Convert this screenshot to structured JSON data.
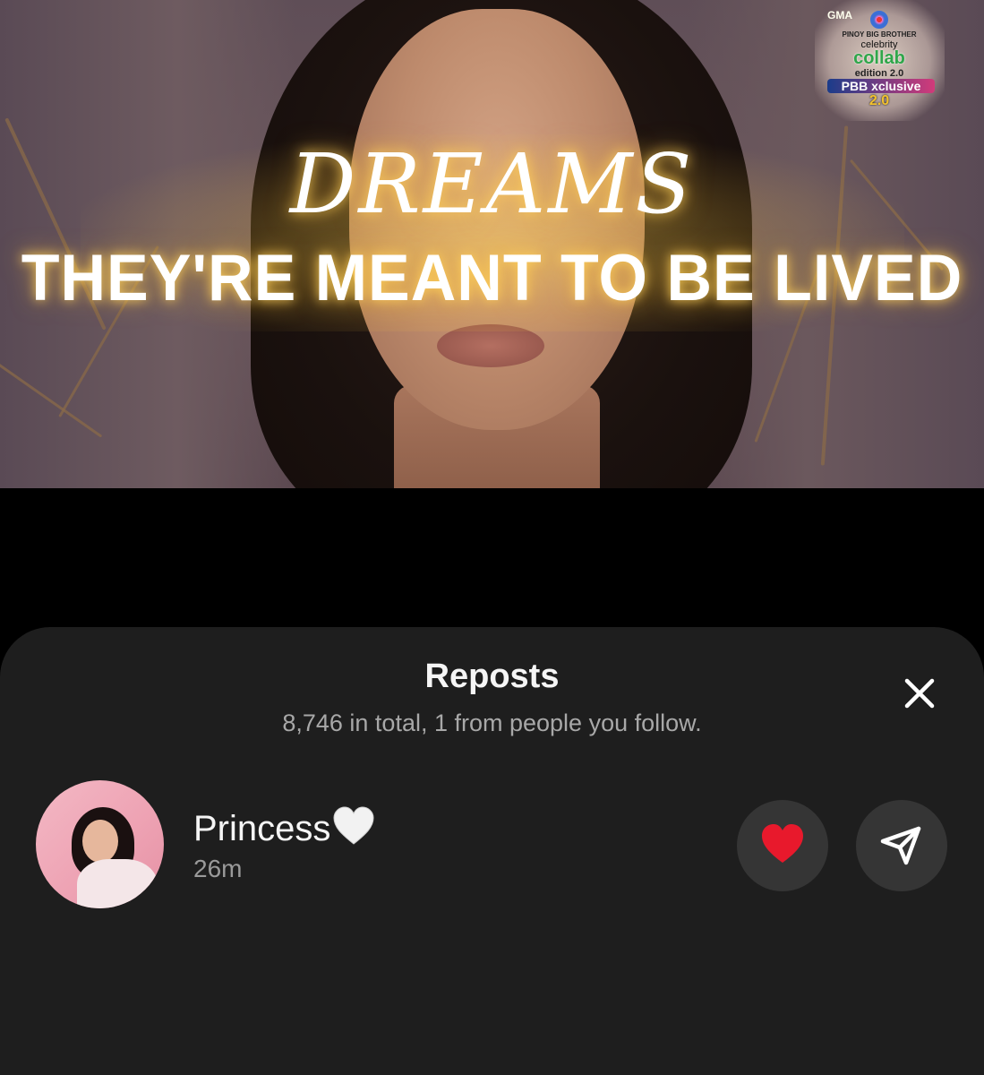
{
  "video": {
    "headline": "DREAMS",
    "subheadline": "THEY'RE MEANT TO BE LIVED",
    "logo": {
      "network": "GMA",
      "line1": "PINOY BIG BROTHER",
      "line2": "celebrity",
      "line3": "collab",
      "line4": "edition 2.0",
      "line5": "PBB xclusive",
      "line6": "2.0"
    }
  },
  "sheet": {
    "title": "Reposts",
    "summary": "8,746 in total, 1 from people you follow.",
    "close_icon": "close-icon",
    "reposters": [
      {
        "name": "Princess",
        "name_emoji": "white-heart-icon",
        "time": "26m",
        "actions": [
          "heart-icon",
          "send-icon"
        ]
      }
    ]
  },
  "colors": {
    "sheet_bg": "#1e1e1e",
    "button_bg": "#353535",
    "heart_red": "#e8192c",
    "subtext": "#a8a8a8"
  }
}
